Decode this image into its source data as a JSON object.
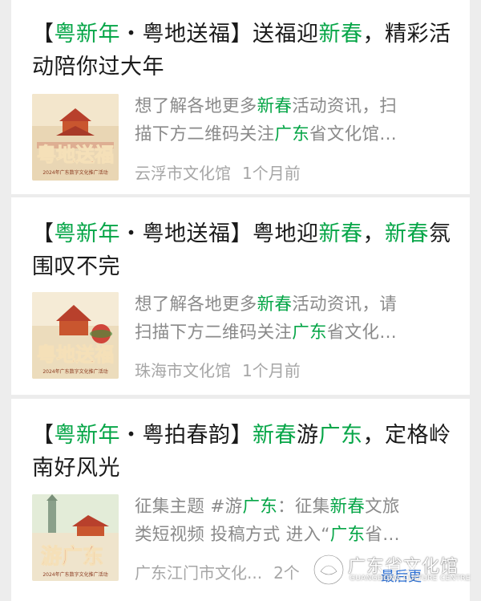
{
  "colors": {
    "highlight": "#07a648",
    "title": "#1a1a1a",
    "summary": "#8a8a8a",
    "meta": "#a6a6a6"
  },
  "articles": [
    {
      "title_parts": [
        "【",
        "粤新年",
        "・粤地送福】送福迎",
        "新春",
        "，精彩活动陪你过大年"
      ],
      "summary_line1_parts": [
        "想了解各地更多",
        "新春",
        "活动资讯，扫"
      ],
      "summary_line2_parts": [
        "描下方二维码关注",
        "广东",
        "省文化馆…"
      ],
      "source": "云浮市文化馆",
      "time": "1个月前",
      "thumb_text": "粤地送福",
      "thumb_caption": "2024年广东数字文化推广活动"
    },
    {
      "title_parts": [
        "【",
        "粤新年",
        "・粤地送福】粤地迎",
        "新春",
        "，",
        "新春",
        "氛围叹不完"
      ],
      "summary_line1_parts": [
        "想了解各地更多",
        "新春",
        "活动资讯，请"
      ],
      "summary_line2_parts": [
        "扫描下方二维码关注",
        "广东",
        "省文化…"
      ],
      "source": "珠海市文化馆",
      "time": "1个月前",
      "thumb_text": "粤地送福",
      "thumb_caption": "2024年广东数字文化推广活动"
    },
    {
      "title_parts": [
        "【",
        "粤新年",
        "・粤拍春韵】",
        "新春",
        "游",
        "广东",
        "，定格岭南好风光"
      ],
      "summary_line1_parts": [
        "征集主题 #游",
        "广东",
        "：征集",
        "新春",
        "文旅"
      ],
      "summary_line2_parts": [
        "类短视频 投稿方式 进入“",
        "广东",
        "省…"
      ],
      "source": "广东江门市文化...",
      "time": "2个",
      "thumb_text": "游广东",
      "thumb_caption": "2024年广东数字文化推广活动"
    }
  ],
  "watermark": {
    "name": "广东省文化馆",
    "english": "GUANGDONG CULTURE CENTRE",
    "overlay_button": "最后更"
  }
}
